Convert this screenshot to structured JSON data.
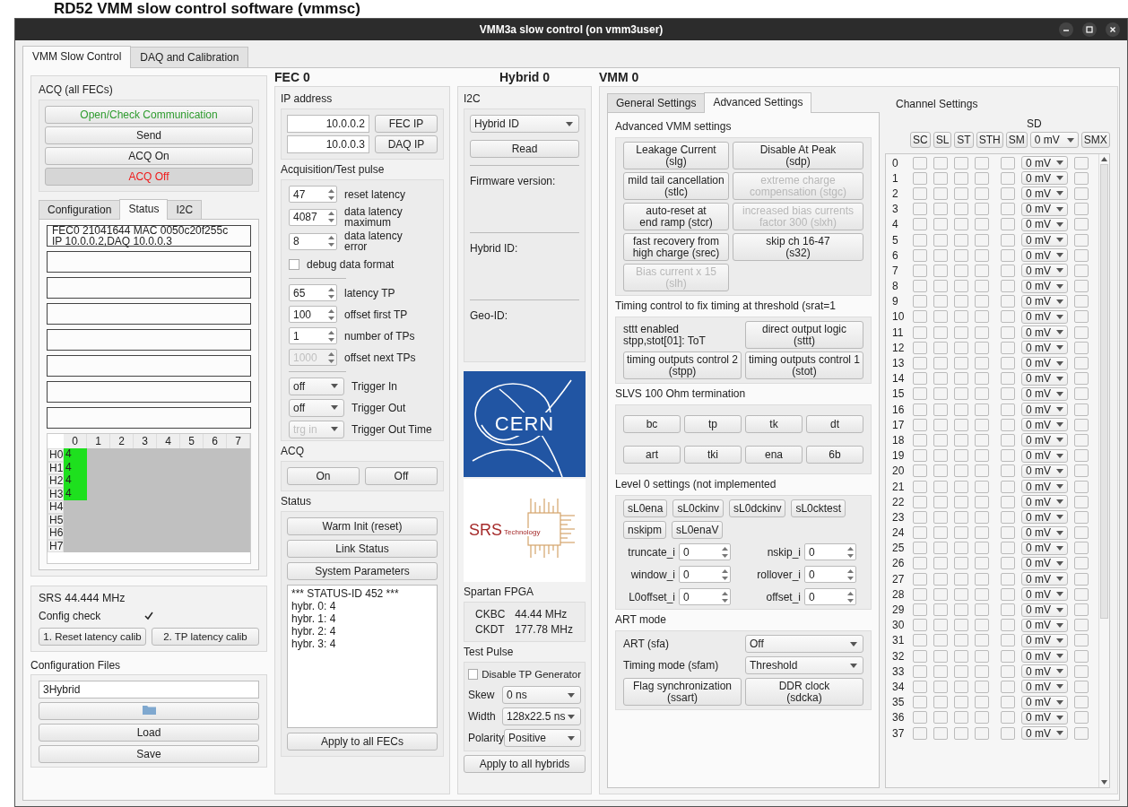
{
  "heading": "RD52 VMM slow control software (vmmsc)",
  "window": {
    "title": "VMM3a slow control (on vmm3user)"
  },
  "main_tabs": [
    {
      "label": "VMM Slow Control",
      "selected": true
    },
    {
      "label": "DAQ and Calibration",
      "selected": false
    }
  ],
  "acq_all": {
    "title": "ACQ (all FECs)",
    "buttons": [
      {
        "label": "Open/Check Communication",
        "kind": "connect",
        "pressed": false
      },
      {
        "label": "Send",
        "kind": "plain",
        "pressed": false
      },
      {
        "label": "ACQ On",
        "kind": "plain",
        "pressed": false
      },
      {
        "label": "ACQ Off",
        "kind": "stop",
        "pressed": true
      }
    ]
  },
  "fec_tabs": [
    {
      "label": "Configuration",
      "selected": false
    },
    {
      "label": "Status",
      "selected": true
    },
    {
      "label": "I2C",
      "selected": false
    }
  ],
  "fec_slots": [
    {
      "lines": [
        "FEC0 21041644 MAC 0050c20f255c",
        "IP 10.0.0.2,DAQ 10.0.0.3"
      ]
    },
    {
      "empty": true
    },
    {
      "empty": true
    },
    {
      "empty": true
    },
    {
      "empty": true
    },
    {
      "empty": true
    },
    {
      "empty": true
    },
    {
      "empty": true
    }
  ],
  "hybrid_grid": {
    "columns": [
      "0",
      "1",
      "2",
      "3",
      "4",
      "5",
      "6",
      "7"
    ],
    "rows": [
      {
        "label": "H0",
        "cells": [
          "4",
          null,
          null,
          null,
          null,
          null,
          null,
          null
        ]
      },
      {
        "label": "H1",
        "cells": [
          "4",
          null,
          null,
          null,
          null,
          null,
          null,
          null
        ]
      },
      {
        "label": "H2",
        "cells": [
          "4",
          null,
          null,
          null,
          null,
          null,
          null,
          null
        ]
      },
      {
        "label": "H3",
        "cells": [
          "4",
          null,
          null,
          null,
          null,
          null,
          null,
          null
        ]
      },
      {
        "label": "H4",
        "cells": [
          null,
          null,
          null,
          null,
          null,
          null,
          null,
          null
        ]
      },
      {
        "label": "H5",
        "cells": [
          null,
          null,
          null,
          null,
          null,
          null,
          null,
          null
        ]
      },
      {
        "label": "H6",
        "cells": [
          null,
          null,
          null,
          null,
          null,
          null,
          null,
          null
        ]
      },
      {
        "label": "H7",
        "cells": [
          null,
          null,
          null,
          null,
          null,
          null,
          null,
          null
        ]
      }
    ]
  },
  "srs": {
    "clock": "SRS 44.444 MHz",
    "config_check": {
      "label": "Config check",
      "checked": true
    },
    "buttons": [
      "1. Reset latency calib",
      "2. TP latency calib"
    ]
  },
  "config_files": {
    "title": "Configuration Files",
    "value": "3Hybrid",
    "buttons": [
      "Load",
      "Save"
    ]
  },
  "fec": {
    "title": "FEC 0",
    "ip": {
      "title": "IP address",
      "rows": [
        {
          "value": "10.0.0.2",
          "button": "FEC IP"
        },
        {
          "value": "10.0.0.3",
          "button": "DAQ IP"
        }
      ]
    },
    "acquisition": {
      "title": "Acquisition/Test pulse",
      "latency": [
        {
          "kind": "spin",
          "value": "47",
          "label": "reset latency",
          "disabled": false
        },
        {
          "kind": "spin",
          "value": "4087",
          "label": "data latency maximum",
          "disabled": false
        },
        {
          "kind": "spin",
          "value": "8",
          "label": "data latency error",
          "disabled": false
        }
      ],
      "debug": {
        "label": "debug data format",
        "checked": false
      },
      "test_pulse": [
        {
          "kind": "spin",
          "value": "65",
          "label": "latency TP",
          "disabled": false
        },
        {
          "kind": "spin",
          "value": "100",
          "label": "offset first TP",
          "disabled": false
        },
        {
          "kind": "spin",
          "value": "1",
          "label": "number of TPs",
          "disabled": false
        },
        {
          "kind": "spin",
          "value": "1000",
          "label": "offset next TPs",
          "disabled": true
        }
      ],
      "trigger": [
        {
          "kind": "select",
          "value": "off",
          "label": "Trigger In",
          "disabled": false
        },
        {
          "kind": "select",
          "value": "off",
          "label": "Trigger Out",
          "disabled": false
        },
        {
          "kind": "select",
          "value": "trg in",
          "label": "Trigger Out Time",
          "disabled": true
        }
      ]
    },
    "acq": {
      "title": "ACQ",
      "buttons": [
        "On",
        "Off"
      ]
    },
    "status": {
      "title": "Status",
      "buttons": [
        "Warm Init (reset)",
        "Link Status",
        "System Parameters"
      ],
      "log": [
        "*** STATUS-ID 452 ***",
        "hybr. 0: 4",
        "hybr. 1: 4",
        "hybr. 2: 4",
        "hybr. 3: 4"
      ],
      "apply": "Apply to all FECs"
    }
  },
  "hybrid": {
    "title": "Hybrid 0",
    "i2c": {
      "title": "I2C",
      "select": "Hybrid ID",
      "button": "Read",
      "fields": [
        "Firmware version:",
        "Hybrid ID:",
        "Geo-ID:"
      ]
    },
    "logos": [
      {
        "kind": "cern",
        "text": "CERN"
      },
      {
        "kind": "srs",
        "text": "SRS",
        "subtext": "Technology"
      }
    ],
    "fpga": {
      "title": "Spartan FPGA",
      "clocks": [
        {
          "name": "CKBC",
          "value": "44.44 MHz"
        },
        {
          "name": "CKDT",
          "value": "177.78 MHz"
        }
      ]
    },
    "test_pulse": {
      "title": "Test Pulse",
      "disable": {
        "label": "Disable TP Generator",
        "checked": false
      },
      "selects": [
        {
          "label": "Skew",
          "value": "0 ns"
        },
        {
          "label": "Width",
          "value": "128x22.5 ns"
        },
        {
          "label": "Polarity",
          "value": "Positive"
        }
      ]
    },
    "apply": "Apply to all hybrids"
  },
  "vmm": {
    "title": "VMM 0",
    "tabs": [
      {
        "label": "General Settings",
        "selected": false
      },
      {
        "label": "Advanced Settings",
        "selected": true
      }
    ],
    "advanced": {
      "title": "Advanced VMM settings",
      "buttons": [
        {
          "lines": [
            "Leakage Current",
            "(slg)"
          ],
          "disabled": false
        },
        {
          "lines": [
            "Disable At Peak",
            "(sdp)"
          ],
          "disabled": false
        },
        {
          "lines": [
            "mild tail cancellation",
            "(stlc)"
          ],
          "disabled": false
        },
        {
          "lines": [
            "extreme charge",
            "compensation (stgc)"
          ],
          "disabled": true
        },
        {
          "lines": [
            "auto-reset at",
            "end ramp (stcr)"
          ],
          "disabled": false
        },
        {
          "lines": [
            "increased bias currents",
            "factor 300 (slxh)"
          ],
          "disabled": true
        },
        {
          "lines": [
            "fast recovery from",
            "high charge (srec)"
          ],
          "disabled": false
        },
        {
          "lines": [
            "skip ch 16-47",
            "(s32)"
          ],
          "disabled": false
        },
        {
          "lines": [
            "Bias current x 15",
            "(slh)"
          ],
          "disabled": true
        }
      ]
    },
    "timing": {
      "title": "Timing control to fix timing at threshold (srat=1",
      "note": [
        "sttt enabled",
        "stpp,stot[01]: ToT"
      ],
      "buttons": [
        {
          "lines": [
            "direct output logic",
            "(sttt)"
          ]
        },
        {
          "lines": [
            "timing outputs control 2",
            "(stpp)"
          ]
        },
        {
          "lines": [
            "timing outputs control 1",
            "(stot)"
          ]
        }
      ]
    },
    "slvs": {
      "title": "SLVS 100 Ohm termination",
      "buttons": [
        "bc",
        "tp",
        "tk",
        "dt",
        "art",
        "tki",
        "ena",
        "6b"
      ]
    },
    "level0": {
      "title": "Level 0 settings (not implemented",
      "buttons": [
        "sL0ena",
        "sL0ckinv",
        "sL0dckinv",
        "sL0cktest",
        "nskipm",
        "sL0enaV"
      ],
      "fields": [
        {
          "label": "truncate_i",
          "value": "0"
        },
        {
          "label": "nskip_i",
          "value": "0"
        },
        {
          "label": "window_i",
          "value": "0"
        },
        {
          "label": "rollover_i",
          "value": "0"
        },
        {
          "label": "L0offset_i",
          "value": "0"
        },
        {
          "label": "offset_i",
          "value": "0"
        }
      ]
    },
    "art": {
      "title": "ART mode",
      "selects": [
        {
          "label": "ART (sfa)",
          "value": "Off"
        },
        {
          "label": "Timing mode (sfam)",
          "value": "Threshold"
        }
      ],
      "buttons": [
        {
          "lines": [
            "Flag synchronization",
            "(ssart)"
          ]
        },
        {
          "lines": [
            "DDR clock",
            "(sdcka)"
          ]
        }
      ]
    }
  },
  "channels": {
    "title": "Channel Settings",
    "sd_label": "SD",
    "header": [
      "SC",
      "SL",
      "ST",
      "STH",
      "SM"
    ],
    "header_select": "0 mV",
    "header_last": "SMX",
    "rows": [
      {
        "number": "0",
        "sd": "0 mV",
        "checked": [
          false,
          false,
          false,
          false,
          false,
          false
        ]
      },
      {
        "number": "1",
        "sd": "0 mV",
        "checked": [
          false,
          false,
          false,
          false,
          false,
          false
        ]
      },
      {
        "number": "2",
        "sd": "0 mV",
        "checked": [
          false,
          false,
          false,
          false,
          false,
          false
        ]
      },
      {
        "number": "3",
        "sd": "0 mV",
        "checked": [
          false,
          false,
          false,
          false,
          false,
          false
        ]
      },
      {
        "number": "4",
        "sd": "0 mV",
        "checked": [
          false,
          false,
          false,
          false,
          false,
          false
        ]
      },
      {
        "number": "5",
        "sd": "0 mV",
        "checked": [
          false,
          false,
          false,
          false,
          false,
          false
        ]
      },
      {
        "number": "6",
        "sd": "0 mV",
        "checked": [
          false,
          false,
          false,
          false,
          false,
          false
        ]
      },
      {
        "number": "7",
        "sd": "0 mV",
        "checked": [
          false,
          false,
          false,
          false,
          false,
          false
        ]
      },
      {
        "number": "8",
        "sd": "0 mV",
        "checked": [
          false,
          false,
          false,
          false,
          false,
          false
        ]
      },
      {
        "number": "9",
        "sd": "0 mV",
        "checked": [
          false,
          false,
          false,
          false,
          false,
          false
        ]
      },
      {
        "number": "10",
        "sd": "0 mV",
        "checked": [
          false,
          false,
          false,
          false,
          false,
          false
        ]
      },
      {
        "number": "11",
        "sd": "0 mV",
        "checked": [
          false,
          false,
          false,
          false,
          false,
          false
        ]
      },
      {
        "number": "12",
        "sd": "0 mV",
        "checked": [
          false,
          false,
          false,
          false,
          false,
          false
        ]
      },
      {
        "number": "13",
        "sd": "0 mV",
        "checked": [
          false,
          false,
          false,
          false,
          false,
          false
        ]
      },
      {
        "number": "14",
        "sd": "0 mV",
        "checked": [
          false,
          false,
          false,
          false,
          false,
          false
        ]
      },
      {
        "number": "15",
        "sd": "0 mV",
        "checked": [
          false,
          false,
          false,
          false,
          false,
          false
        ]
      },
      {
        "number": "16",
        "sd": "0 mV",
        "checked": [
          false,
          false,
          false,
          false,
          false,
          false
        ]
      },
      {
        "number": "17",
        "sd": "0 mV",
        "checked": [
          false,
          false,
          false,
          false,
          false,
          false
        ]
      },
      {
        "number": "18",
        "sd": "0 mV",
        "checked": [
          false,
          false,
          false,
          false,
          false,
          false
        ]
      },
      {
        "number": "19",
        "sd": "0 mV",
        "checked": [
          false,
          false,
          false,
          false,
          false,
          false
        ]
      },
      {
        "number": "20",
        "sd": "0 mV",
        "checked": [
          false,
          false,
          false,
          false,
          false,
          false
        ]
      },
      {
        "number": "21",
        "sd": "0 mV",
        "checked": [
          false,
          false,
          false,
          false,
          false,
          false
        ]
      },
      {
        "number": "22",
        "sd": "0 mV",
        "checked": [
          false,
          false,
          false,
          false,
          false,
          false
        ]
      },
      {
        "number": "23",
        "sd": "0 mV",
        "checked": [
          false,
          false,
          false,
          false,
          false,
          false
        ]
      },
      {
        "number": "24",
        "sd": "0 mV",
        "checked": [
          false,
          false,
          false,
          false,
          false,
          false
        ]
      },
      {
        "number": "25",
        "sd": "0 mV",
        "checked": [
          false,
          false,
          false,
          false,
          false,
          false
        ]
      },
      {
        "number": "26",
        "sd": "0 mV",
        "checked": [
          false,
          false,
          false,
          false,
          false,
          false
        ]
      },
      {
        "number": "27",
        "sd": "0 mV",
        "checked": [
          false,
          false,
          false,
          false,
          false,
          false
        ]
      },
      {
        "number": "28",
        "sd": "0 mV",
        "checked": [
          false,
          false,
          false,
          false,
          false,
          false
        ]
      },
      {
        "number": "29",
        "sd": "0 mV",
        "checked": [
          false,
          false,
          false,
          false,
          false,
          false
        ]
      },
      {
        "number": "30",
        "sd": "0 mV",
        "checked": [
          false,
          false,
          false,
          false,
          false,
          false
        ]
      },
      {
        "number": "31",
        "sd": "0 mV",
        "checked": [
          false,
          false,
          false,
          false,
          false,
          false
        ]
      },
      {
        "number": "32",
        "sd": "0 mV",
        "checked": [
          false,
          false,
          false,
          false,
          false,
          false
        ]
      },
      {
        "number": "33",
        "sd": "0 mV",
        "checked": [
          false,
          false,
          false,
          false,
          false,
          false
        ]
      },
      {
        "number": "34",
        "sd": "0 mV",
        "checked": [
          false,
          false,
          false,
          false,
          false,
          false
        ]
      },
      {
        "number": "35",
        "sd": "0 mV",
        "checked": [
          false,
          false,
          false,
          false,
          false,
          false
        ]
      },
      {
        "number": "36",
        "sd": "0 mV",
        "checked": [
          false,
          false,
          false,
          false,
          false,
          false
        ]
      },
      {
        "number": "37",
        "sd": "0 mV",
        "checked": [
          false,
          false,
          false,
          false,
          false,
          false
        ]
      }
    ]
  }
}
